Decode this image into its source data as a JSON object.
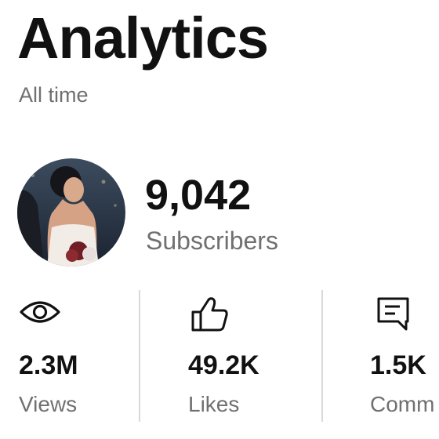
{
  "header": {
    "title": "Analytics",
    "time_range": "All time"
  },
  "channel": {
    "avatar_icon": "profile-photo",
    "subscriber_count": "9,042",
    "subscriber_label": "Subscribers"
  },
  "stats": [
    {
      "icon": "eye-icon",
      "value": "2.3M",
      "label": "Views"
    },
    {
      "icon": "thumbs-up-icon",
      "value": "49.2K",
      "label": "Likes"
    },
    {
      "icon": "comment-icon",
      "value": "1.5K",
      "label": "Comm"
    }
  ],
  "colors": {
    "primary_text": "#111111",
    "secondary_text": "#707070",
    "divider": "#d9d9d9"
  }
}
